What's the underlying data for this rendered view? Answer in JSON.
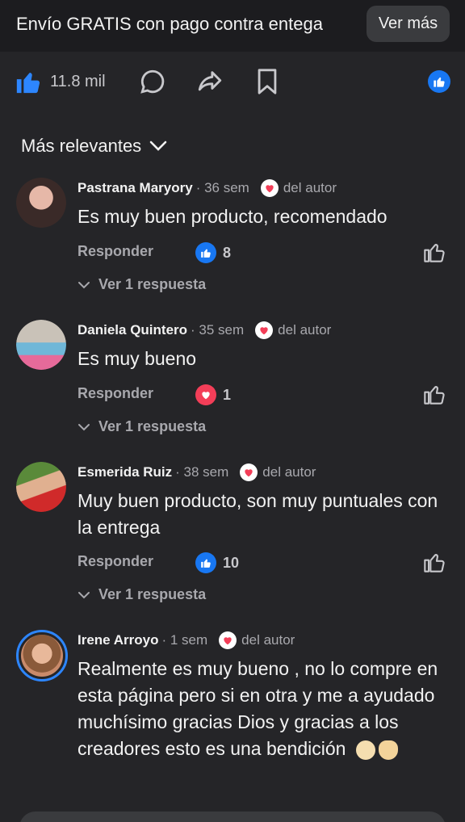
{
  "banner": {
    "title": "Envío GRATIS con pago contra entega",
    "button": "Ver más"
  },
  "post_actions": {
    "like_count": "11.8 mil"
  },
  "sort": {
    "label": "Más relevantes"
  },
  "comments": [
    {
      "name": "Pastrana Maryory",
      "time": "· 36 sem",
      "author_badge": "del autor",
      "text": "Es muy buen producto, recomendado",
      "reply_label": "Responder",
      "reaction": "like",
      "reaction_count": "8",
      "view_replies": "Ver 1 respuesta"
    },
    {
      "name": "Daniela Quintero",
      "time": "· 35 sem",
      "author_badge": "del autor",
      "text": "Es muy bueno",
      "reply_label": "Responder",
      "reaction": "love",
      "reaction_count": "1",
      "view_replies": "Ver 1 respuesta"
    },
    {
      "name": "Esmerida Ruiz",
      "time": "· 38 sem",
      "author_badge": "del autor",
      "text": "Muy buen producto, son muy puntuales con la entrega",
      "reply_label": "Responder",
      "reaction": "like",
      "reaction_count": "10",
      "view_replies": "Ver 1 respuesta"
    },
    {
      "name": "Irene Arroyo",
      "time": "· 1 sem",
      "author_badge": "del autor",
      "text": "Realmente es muy bueno , no lo compre en esta página pero si en otra y me a ayudado muchísimo gracias Dios y gracias a los creadores esto es una bendición",
      "emojis": [
        "clapping-hands-emoji",
        "folded-hands-emoji"
      ]
    }
  ],
  "colors": {
    "background": "#252528",
    "banner": "#1c1c1f",
    "like_blue": "#1877f2",
    "love_red": "#f33e58"
  }
}
